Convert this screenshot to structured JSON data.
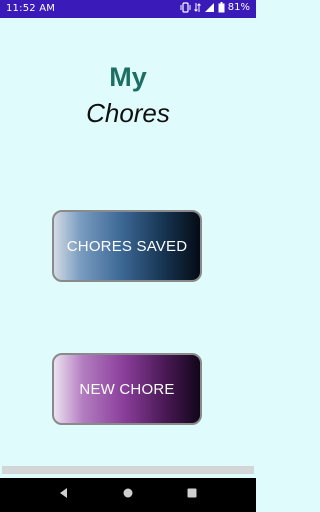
{
  "status_bar": {
    "time": "11:52 AM",
    "battery_percent": "81%",
    "icons": [
      "vibrate-icon",
      "data-icon",
      "signal-icon",
      "battery-icon"
    ]
  },
  "title": {
    "line1": "My",
    "line2": "Chores"
  },
  "buttons": {
    "chores_saved": "CHORES SAVED",
    "new_chore": "NEW CHORE"
  },
  "nav_bar": {
    "icons": [
      "back-icon",
      "home-icon",
      "recents-icon"
    ]
  },
  "colors": {
    "status_bar": "#3a1ab8",
    "background": "#e0fbfc",
    "title_accent": "#1d6f63"
  }
}
